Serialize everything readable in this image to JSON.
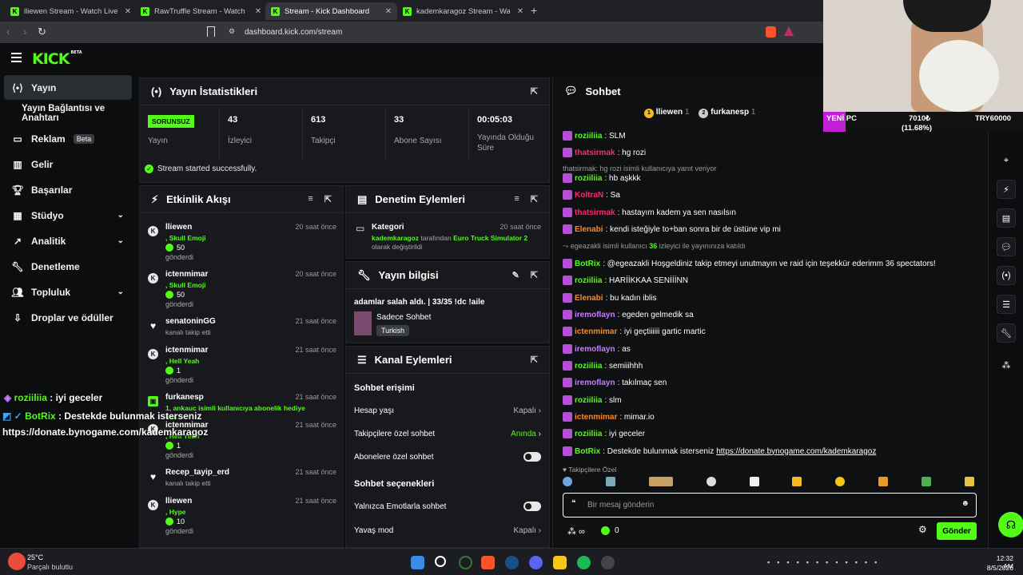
{
  "browser": {
    "tabs": [
      {
        "label": "lliewen Stream - Watch Live on K"
      },
      {
        "label": "RawTruffle Stream - Watch Live o"
      },
      {
        "label": "Stream - Kick Dashboard"
      },
      {
        "label": "kademkaragoz Stream - Watch Li"
      }
    ],
    "url": "dashboard.kick.com/stream"
  },
  "app": {
    "logo": "KICK",
    "beta": "BETA"
  },
  "sidebar": {
    "items": [
      {
        "label": "Yayın"
      },
      {
        "label": "Yayın Bağlantısı ve Anahtarı"
      },
      {
        "label": "Reklam",
        "badge": "Beta"
      },
      {
        "label": "Gelir"
      },
      {
        "label": "Başarılar"
      },
      {
        "label": "Stüdyo"
      },
      {
        "label": "Analitik"
      },
      {
        "label": "Denetleme"
      },
      {
        "label": "Topluluk"
      },
      {
        "label": "Droplar ve ödüller"
      }
    ]
  },
  "stats": {
    "title": "Yayın İstatistikleri",
    "status_badge": "SORUNSUZ",
    "status_label": "Yayın",
    "cells": [
      {
        "value": "43",
        "label": "İzleyici"
      },
      {
        "value": "613",
        "label": "Takipçi"
      },
      {
        "value": "33",
        "label": "Abone Sayısı"
      },
      {
        "value": "00:05:03",
        "label": "Yayında Olduğu Süre"
      }
    ],
    "success": "Stream started successfully."
  },
  "activity": {
    "title": "Etkinlik Akışı",
    "events": [
      {
        "user": "lliewen",
        "time": "20 saat önce",
        "detail": ", Skull Emoji",
        "amount": "50",
        "sent": "gönderdi"
      },
      {
        "user": "ictenmimar",
        "time": "20 saat önce",
        "detail": ", Skull Emoji",
        "amount": "50",
        "sent": "gönderdi"
      },
      {
        "user": "senatoninGG",
        "time": "21 saat önce",
        "detail": "kanalı takip etti"
      },
      {
        "user": "ictenmimar",
        "time": "21 saat önce",
        "detail": ", Hell Yeah",
        "amount": "1",
        "sent": "gönderdi"
      },
      {
        "user": "furkanesp",
        "time": "21 saat önce",
        "detail": "1, ankauc isimli kullanıcıya abonelik hediye etti."
      },
      {
        "user": "ictenmimar",
        "time": "21 saat önce",
        "detail": ", Hell Yeah",
        "amount": "1",
        "sent": "gönderdi"
      },
      {
        "user": "Recep_tayip_erd",
        "time": "21 saat önce",
        "detail": "kanalı takip etti"
      },
      {
        "user": "lliewen",
        "time": "21 saat önce",
        "detail": ", Hype",
        "amount": "10",
        "sent": "gönderdi"
      }
    ]
  },
  "moderation": {
    "title": "Denetim Eylemleri",
    "item": {
      "title": "Kategori",
      "time": "20 saat önce",
      "user": "kademkaragoz",
      "mid": "tarafından",
      "game": "Euro Truck Simulator 2",
      "end": "olarak değiştirildi"
    }
  },
  "streaminfo": {
    "title": "Yayın bilgisi",
    "stream_title": "adamlar salah aldı. | 33/35 !dc !aile",
    "chat_mode": "Sadece Sohbet",
    "language": "Turkish"
  },
  "channel": {
    "title": "Kanal Eylemleri",
    "section1": "Sohbet erişimi",
    "rows": [
      {
        "label": "Hesap yaşı",
        "value": "Kapalı"
      },
      {
        "label": "Takipçilere özel sohbet",
        "value": "Anında"
      },
      {
        "label": "Abonelere özel sohbet",
        "value": ""
      }
    ],
    "section2": "Sohbet seçenekleri",
    "rows2": [
      {
        "label": "Yalnızca Emotlarla sohbet",
        "value": ""
      },
      {
        "label": "Yavaş mod",
        "value": "Kapalı"
      }
    ]
  },
  "chat": {
    "title": "Sohbet",
    "pinned": [
      {
        "rank": "1",
        "name": "lliewen",
        "count": "1"
      },
      {
        "rank": "2",
        "name": "furkanesp",
        "count": "1"
      }
    ],
    "messages": [
      {
        "user": "roziiliia",
        "color": "#53fc18",
        "text": ": SLM"
      },
      {
        "user": "thatsirmak",
        "color": "#ff2b6a",
        "text": ": hg rozi"
      },
      {
        "sys": "thatsirmak: hg rozi isimli kullanıcıya yanıt veriyor"
      },
      {
        "user": "roziiliia",
        "color": "#53fc18",
        "text": ": hb aşkkk"
      },
      {
        "user": "KoltraN",
        "color": "#ff2b6a",
        "text": ": Sa"
      },
      {
        "user": "thatsirmak",
        "color": "#ff2b6a",
        "text": ": hastayım kadem ya sen nasılsın"
      },
      {
        "user": "Elenabi",
        "color": "#ff8a1f",
        "text": ": kendi isteğiyle to+ban sonra bir de üstüne vip mi"
      },
      {
        "raid": "egeazakli isimli kullanıcı",
        "raidnum": "36",
        "raidend": "izleyici ile yayınınıza katıldı"
      },
      {
        "user": "BotRix",
        "color": "#53fc18",
        "text": ": @egeazakli Hoşgeldiniz takip etmeyi unutmayın ve raid için teşekkür ederimm 36 spectators!"
      },
      {
        "user": "roziiliia",
        "color": "#53fc18",
        "text": ": HARİİKKAA SENİİİNN"
      },
      {
        "user": "Elenabi",
        "color": "#ff8a1f",
        "text": ": bu kadın iblis"
      },
      {
        "user": "iremoflayn",
        "color": "#c77dff",
        "text": ": egeden gelmedik sa"
      },
      {
        "user": "ictenmimar",
        "color": "#ff8a1f",
        "text": ": iyi geçtiiiiii gartic martic"
      },
      {
        "user": "iremoflayn",
        "color": "#c77dff",
        "text": ": as"
      },
      {
        "user": "roziiliia",
        "color": "#53fc18",
        "text": ": semiiihhh"
      },
      {
        "user": "iremoflayn",
        "color": "#c77dff",
        "text": ": takılmaç sen"
      },
      {
        "user": "roziiliia",
        "color": "#53fc18",
        "text": ": slm"
      },
      {
        "user": "ictenmimar",
        "color": "#ff8a1f",
        "text": ": mimar.io"
      },
      {
        "user": "roziiliia",
        "color": "#53fc18",
        "text": ": iyi geceler"
      },
      {
        "user": "BotRix",
        "color": "#53fc18",
        "text": ": Destekde bulunmak isterseniz ",
        "link": "https://donate.bynogame.com/kademkaragoz"
      }
    ],
    "follower_label": "Takipçilere Özel",
    "placeholder": "Bir mesaj gönderin",
    "points": "0",
    "send": "Gönder"
  },
  "overlay": {
    "pc": "YENİ PC",
    "amount": "7010₺",
    "pct": "(11.68%)",
    "target": "TRY60000",
    "line1_user": "roziiliia",
    "line1_text": " : iyi geceler",
    "line2_user": "BotRix",
    "line2_text": " : Destekde bulunmak isterseniz",
    "line3": "https://donate.bynogame.com/kademkaragoz"
  },
  "taskbar": {
    "temp": "25°C",
    "weather": "Parçalı bulutlu",
    "time": "12:32 AM",
    "date": "8/5/2026"
  },
  "colors": {
    "accent": "#53fc18",
    "panel": "#17191c",
    "bg": "#0b0d0f"
  }
}
